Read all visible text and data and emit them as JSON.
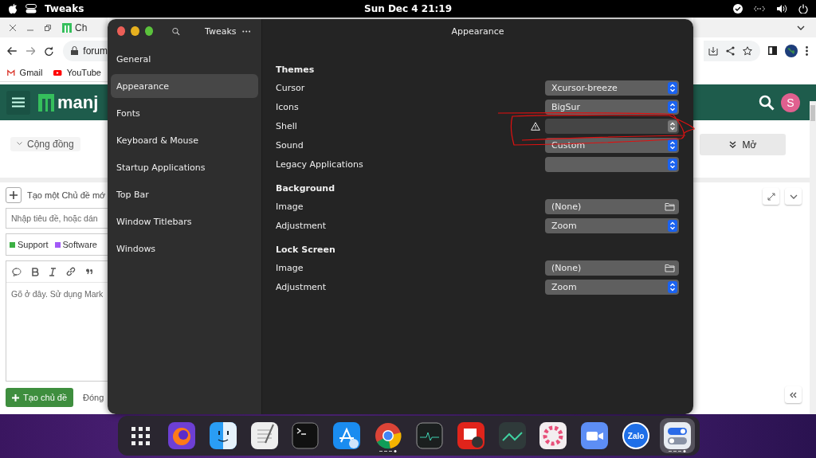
{
  "top_bar": {
    "app_name": "Tweaks",
    "clock": "Sun Dec 4 21:19"
  },
  "browser": {
    "tab_title": "Ch",
    "address": "forum",
    "bookmarks": [
      "Gmail",
      "YouTube"
    ],
    "site_logo": "manj",
    "avatar_letter": "S",
    "category_filter": "Cộng đồng",
    "expand_button": "Mở",
    "composer": {
      "heading": "Tạo một Chủ đề mớ",
      "title_placeholder": "Nhập tiêu đề, hoặc dán",
      "tags": [
        {
          "label": "Support",
          "color": "#3cb043"
        },
        {
          "label": "Software",
          "color": "#a259f7"
        }
      ],
      "editor_placeholder": "Gõ ở đây. Sử dụng Mark",
      "submit": "Tạo chủ đề",
      "close": "Đóng"
    }
  },
  "tweaks": {
    "title": "Tweaks",
    "page_title": "Appearance",
    "sidebar": [
      {
        "label": "General",
        "selected": false
      },
      {
        "label": "Appearance",
        "selected": true
      },
      {
        "label": "Fonts",
        "selected": false
      },
      {
        "label": "Keyboard & Mouse",
        "selected": false
      },
      {
        "label": "Startup Applications",
        "selected": false
      },
      {
        "label": "Top Bar",
        "selected": false
      },
      {
        "label": "Window Titlebars",
        "selected": false
      },
      {
        "label": "Windows",
        "selected": false
      }
    ],
    "sections": [
      {
        "title": "Themes",
        "rows": [
          {
            "label": "Cursor",
            "kind": "combo",
            "value": "Xcursor-breeze"
          },
          {
            "label": "Icons",
            "kind": "combo",
            "value": "BigSur"
          },
          {
            "label": "Shell",
            "kind": "combo",
            "warning": true,
            "disabled": true
          },
          {
            "label": "Sound",
            "kind": "combo",
            "value": "Custom"
          },
          {
            "label": "Legacy Applications",
            "kind": "combo"
          }
        ]
      },
      {
        "title": "Background",
        "rows": [
          {
            "label": "Image",
            "kind": "file",
            "value": "(None)"
          },
          {
            "label": "Adjustment",
            "kind": "combo",
            "value": "Zoom"
          }
        ]
      },
      {
        "title": "Lock Screen",
        "rows": [
          {
            "label": "Image",
            "kind": "file",
            "value": "(None)"
          },
          {
            "label": "Adjustment",
            "kind": "combo",
            "value": "Zoom"
          }
        ]
      }
    ]
  },
  "dock": {
    "items": [
      {
        "running": false
      },
      {
        "running": false
      },
      {
        "running": false
      },
      {
        "running": false
      },
      {
        "running": false
      },
      {
        "running": false
      },
      {
        "running": true
      },
      {
        "running": false
      },
      {
        "running": false
      },
      {
        "running": false
      },
      {
        "running": false
      },
      {
        "running": false
      },
      {
        "running": false,
        "label": "Zalo"
      },
      {
        "running": true
      }
    ]
  }
}
